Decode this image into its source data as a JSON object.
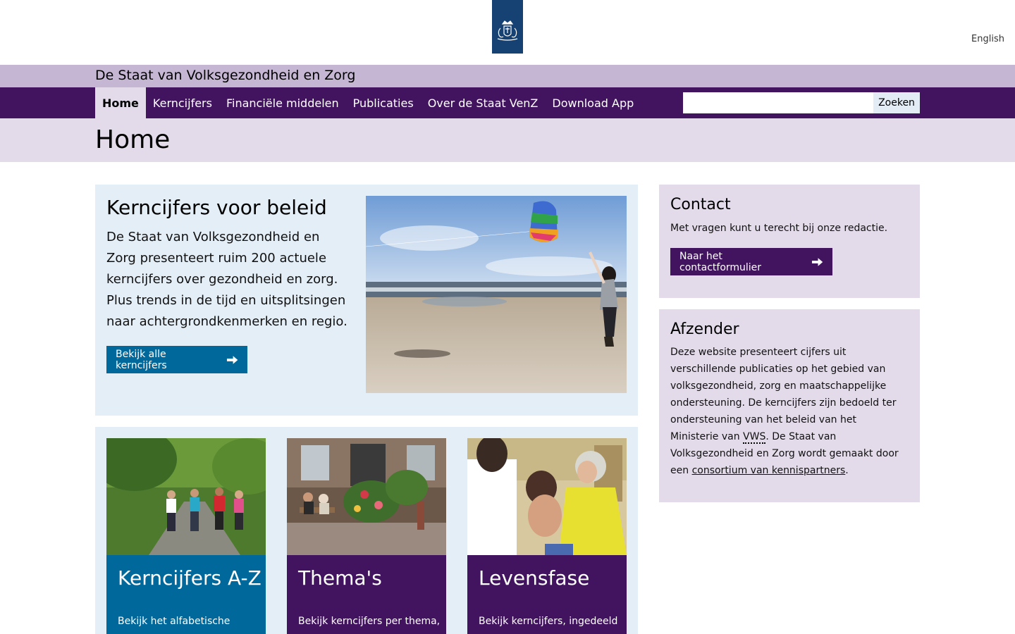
{
  "header": {
    "language_link": "English"
  },
  "site": {
    "title": "De Staat van Volksgezondheid en Zorg"
  },
  "nav": {
    "items": [
      {
        "label": "Home"
      },
      {
        "label": "Kerncijfers"
      },
      {
        "label": "Financiële middelen"
      },
      {
        "label": "Publicaties"
      },
      {
        "label": "Over de Staat VenZ"
      },
      {
        "label": "Download App"
      }
    ],
    "active": "Home",
    "search_value": "",
    "search_button": "Zoeken"
  },
  "page": {
    "title": "Home"
  },
  "hero": {
    "title": "Kerncijfers voor beleid",
    "text": "De Staat van Volksgezondheid en Zorg presenteert ruim 200 actuele kerncijfers over gezondheid en zorg. Plus trends in de tijd en uitsplitsingen naar achtergrondkenmerken en regio.",
    "button": "Bekijk alle kerncijfers"
  },
  "tiles": [
    {
      "title": "Kerncijfers A-Z",
      "text": "Bekijk het alfabetische",
      "color": "#01689b"
    },
    {
      "title": "Thema's",
      "text": "Bekijk kerncijfers per thema,",
      "color": "#42145f"
    },
    {
      "title": "Levensfase",
      "text": "Bekijk kerncijfers, ingedeeld",
      "color": "#42145f"
    }
  ],
  "contact": {
    "title": "Contact",
    "text": "Met vragen kunt u terecht bij onze redactie.",
    "button": "Naar het contactformulier"
  },
  "afzender": {
    "title": "Afzender",
    "text_part1": "Deze website presenteert cijfers uit verschillende publicaties op het gebied van volksgezondheid, zorg en maatschappelijke ondersteuning. De kerncijfers zijn bedoeld ter ondersteuning van het beleid van het Ministerie van ",
    "abbr": "VWS",
    "text_part2": ". De Staat van Volksgezondheid en Zorg wordt gemaakt door een ",
    "link": "consortium van kennispartners",
    "text_part3": "."
  },
  "colors": {
    "brand_purple": "#42145f",
    "brand_blue": "#01689b",
    "logo_blue": "#154273",
    "light_purple": "#e3dbea",
    "light_blue": "#e4eef7"
  }
}
